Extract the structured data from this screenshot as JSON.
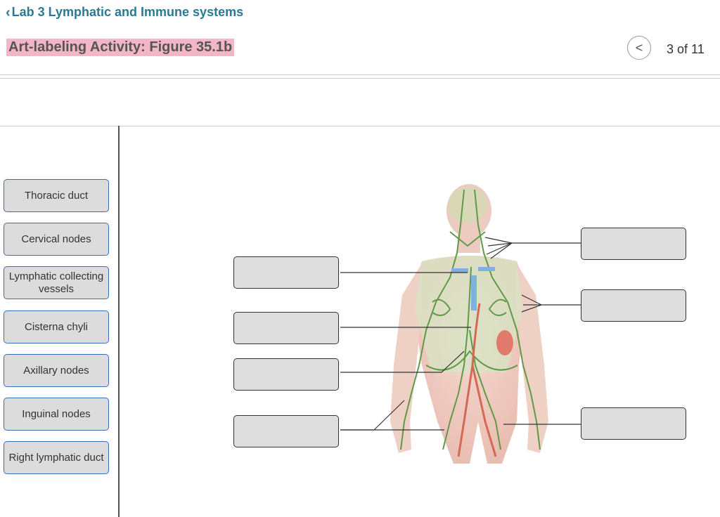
{
  "header": {
    "back_label": "Lab 3 Lymphatic and Immune systems",
    "activity_title": "Art-labeling Activity: Figure 35.1b",
    "page_count": "3 of 11"
  },
  "labels": [
    "Thoracic duct",
    "Cervical nodes",
    "Lymphatic collecting vessels",
    "Cisterna chyli",
    "Axillary nodes",
    "Inguinal nodes",
    "Right lymphatic duct"
  ],
  "icons": {
    "back": "chevron-left-icon",
    "prev": "circle-chevron-left-icon"
  },
  "colors": {
    "accent": "#2a7a95",
    "title_highlight": "#f3b6c6",
    "chip_border": "#3a6db5",
    "lymph_green": "#5f9a48"
  }
}
